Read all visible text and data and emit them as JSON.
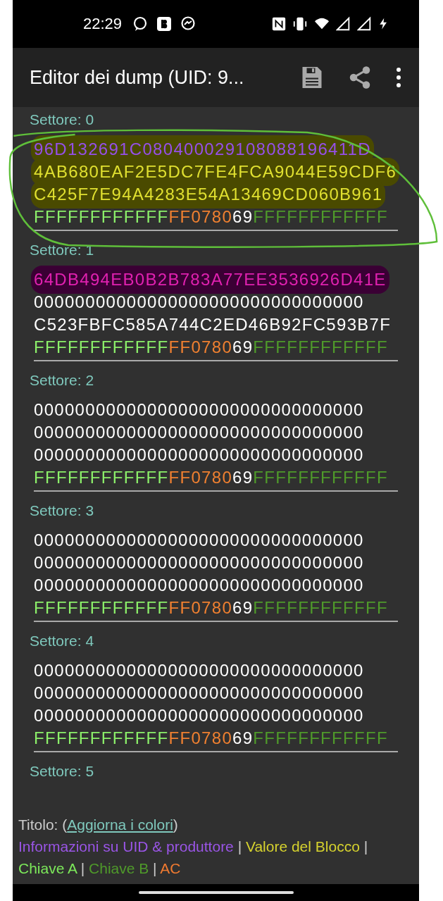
{
  "status_bar": {
    "time": "22:29"
  },
  "toolbar": {
    "title": "Editor dei dump (UID: 9..."
  },
  "sectors": [
    {
      "label": "Settore: 0",
      "blocks": [
        {
          "color": "#4a4a00",
          "segments": [
            {
              "kind": "uid",
              "text": "96D132691C080400029108088196411D"
            }
          ]
        },
        {
          "color": "#4a4a00",
          "segments": [
            {
              "kind": "value",
              "text": "4AB680EAF2E5DC7FE4FCA9044E59CDF6"
            }
          ]
        },
        {
          "color": "#4a4a00",
          "segments": [
            {
              "kind": "value",
              "text": "C425F7E94A4283E54A13469CD060B961"
            }
          ]
        },
        {
          "segments": [
            {
              "kind": "key_a",
              "text": "FFFFFFFFFFFF"
            },
            {
              "kind": "access",
              "text": "FF0780"
            },
            {
              "kind": "user",
              "text": "69"
            },
            {
              "kind": "key_b",
              "text": "FFFFFFFFFFFF"
            }
          ]
        }
      ]
    },
    {
      "label": "Settore: 1",
      "blocks": [
        {
          "color": "#3a0034",
          "segments": [
            {
              "kind": "marked",
              "text": "64DB494EB0B2B783A77EE3536926D41E"
            }
          ]
        },
        {
          "segments": [
            {
              "kind": "data",
              "text": "00000000000000000000000000000000"
            }
          ]
        },
        {
          "segments": [
            {
              "kind": "data",
              "text": "C523FBFC585A744C2ED46B92FC593B7F"
            }
          ]
        },
        {
          "segments": [
            {
              "kind": "key_a",
              "text": "FFFFFFFFFFFF"
            },
            {
              "kind": "access",
              "text": "FF0780"
            },
            {
              "kind": "user",
              "text": "69"
            },
            {
              "kind": "key_b",
              "text": "FFFFFFFFFFFF"
            }
          ]
        }
      ]
    },
    {
      "label": "Settore: 2",
      "blocks": [
        {
          "segments": [
            {
              "kind": "data",
              "text": "00000000000000000000000000000000"
            }
          ]
        },
        {
          "segments": [
            {
              "kind": "data",
              "text": "00000000000000000000000000000000"
            }
          ]
        },
        {
          "segments": [
            {
              "kind": "data",
              "text": "00000000000000000000000000000000"
            }
          ]
        },
        {
          "segments": [
            {
              "kind": "key_a",
              "text": "FFFFFFFFFFFF"
            },
            {
              "kind": "access",
              "text": "FF0780"
            },
            {
              "kind": "user",
              "text": "69"
            },
            {
              "kind": "key_b",
              "text": "FFFFFFFFFFFF"
            }
          ]
        }
      ]
    },
    {
      "label": "Settore: 3",
      "blocks": [
        {
          "segments": [
            {
              "kind": "data",
              "text": "00000000000000000000000000000000"
            }
          ]
        },
        {
          "segments": [
            {
              "kind": "data",
              "text": "00000000000000000000000000000000"
            }
          ]
        },
        {
          "segments": [
            {
              "kind": "data",
              "text": "00000000000000000000000000000000"
            }
          ]
        },
        {
          "segments": [
            {
              "kind": "key_a",
              "text": "FFFFFFFFFFFF"
            },
            {
              "kind": "access",
              "text": "FF0780"
            },
            {
              "kind": "user",
              "text": "69"
            },
            {
              "kind": "key_b",
              "text": "FFFFFFFFFFFF"
            }
          ]
        }
      ]
    },
    {
      "label": "Settore: 4",
      "blocks": [
        {
          "segments": [
            {
              "kind": "data",
              "text": "00000000000000000000000000000000"
            }
          ]
        },
        {
          "segments": [
            {
              "kind": "data",
              "text": "00000000000000000000000000000000"
            }
          ]
        },
        {
          "segments": [
            {
              "kind": "data",
              "text": "00000000000000000000000000000000"
            }
          ]
        },
        {
          "segments": [
            {
              "kind": "key_a",
              "text": "FFFFFFFFFFFF"
            },
            {
              "kind": "access",
              "text": "FF0780"
            },
            {
              "kind": "user",
              "text": "69"
            },
            {
              "kind": "key_b",
              "text": "FFFFFFFFFFFF"
            }
          ]
        }
      ]
    },
    {
      "label": "Settore: 5"
    }
  ],
  "legend": {
    "title": "Titolo: (",
    "link": "Aggiorna i colori",
    "close": ")",
    "items": [
      {
        "kind": "uid",
        "text": "Informazioni su UID & produttore"
      },
      {
        "kind": "value",
        "text": "Valore del Blocco"
      },
      {
        "kind": "key_a",
        "text": "Chiave A"
      },
      {
        "kind": "key_b",
        "text": "Chiave B"
      },
      {
        "kind": "access",
        "text": "AC"
      }
    ],
    "separator": "|"
  }
}
